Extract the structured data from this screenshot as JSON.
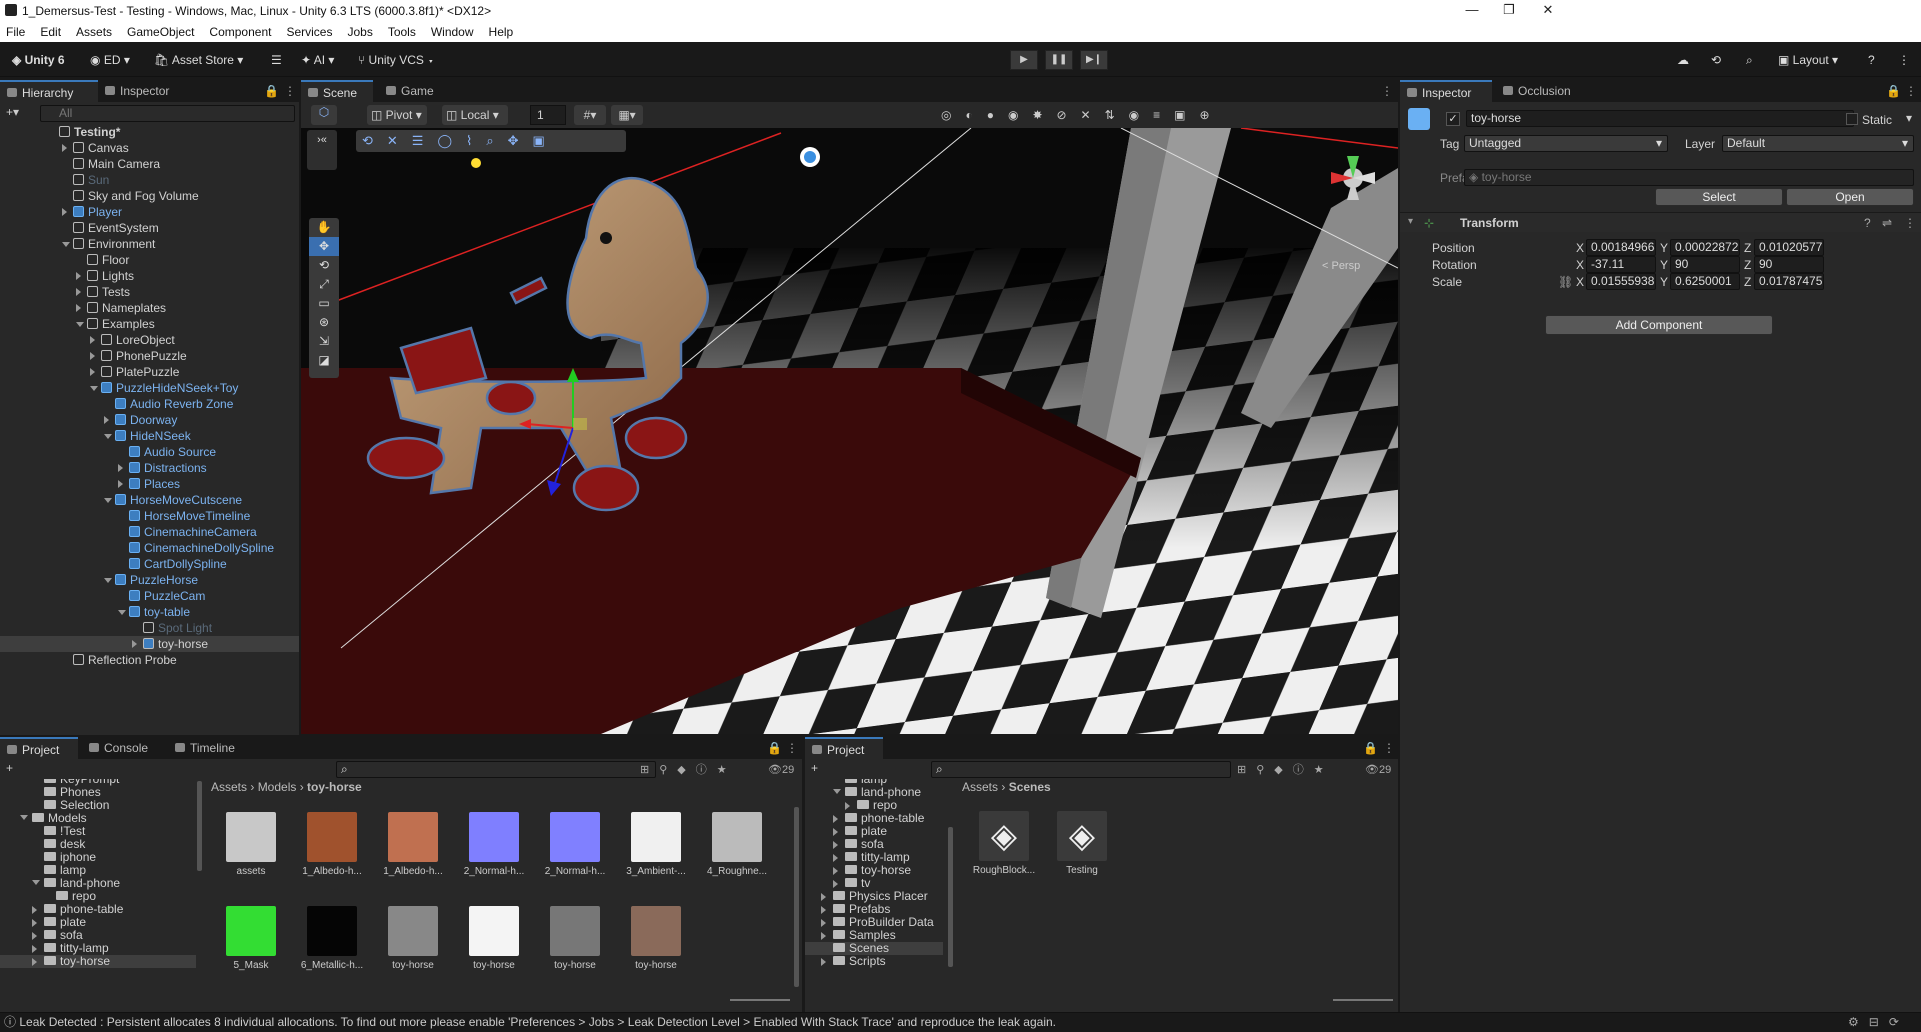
{
  "window": {
    "title": "1_Demersus-Test - Testing - Windows, Mac, Linux - Unity 6.3 LTS (6000.3.8f1)* <DX12>",
    "controls": [
      "—",
      "❐",
      "✕"
    ]
  },
  "menu": [
    "File",
    "Edit",
    "Assets",
    "GameObject",
    "Component",
    "Services",
    "Jobs",
    "Tools",
    "Window",
    "Help"
  ],
  "toolbar": {
    "unity": "Unity 6",
    "account": "ED",
    "asset_store": "Asset Store",
    "ai": "AI",
    "vcs": "Unity VCS",
    "layout": "Layout"
  },
  "hierarchy": {
    "tabs": [
      "Hierarchy",
      "Inspector"
    ],
    "search_placeholder": "All",
    "rows": [
      {
        "label": "Testing*",
        "indent": 0,
        "type": "scene",
        "expanded": true
      },
      {
        "label": "Canvas",
        "indent": 1,
        "type": "go",
        "arrow": "right"
      },
      {
        "label": "Main Camera",
        "indent": 1,
        "type": "go"
      },
      {
        "label": "Sun",
        "indent": 1,
        "type": "dis"
      },
      {
        "label": "Sky and Fog Volume",
        "indent": 1,
        "type": "go"
      },
      {
        "label": "Player",
        "indent": 1,
        "type": "prefab",
        "arrow": "right"
      },
      {
        "label": "EventSystem",
        "indent": 1,
        "type": "go"
      },
      {
        "label": "Environment",
        "indent": 1,
        "type": "go",
        "arrow": "down"
      },
      {
        "label": "Floor",
        "indent": 2,
        "type": "go"
      },
      {
        "label": "Lights",
        "indent": 2,
        "type": "go",
        "arrow": "right"
      },
      {
        "label": "Tests",
        "indent": 2,
        "type": "go",
        "arrow": "right"
      },
      {
        "label": "Nameplates",
        "indent": 2,
        "type": "go",
        "arrow": "right"
      },
      {
        "label": "Examples",
        "indent": 2,
        "type": "go",
        "arrow": "down"
      },
      {
        "label": "LoreObject",
        "indent": 3,
        "type": "go",
        "arrow": "right"
      },
      {
        "label": "PhonePuzzle",
        "indent": 3,
        "type": "go",
        "arrow": "right"
      },
      {
        "label": "PlatePuzzle",
        "indent": 3,
        "type": "go",
        "arrow": "right"
      },
      {
        "label": "PuzzleHideNSeek+Toy",
        "indent": 3,
        "type": "prefab",
        "arrow": "down"
      },
      {
        "label": "Audio Reverb Zone",
        "indent": 4,
        "type": "prefab"
      },
      {
        "label": "Doorway",
        "indent": 4,
        "type": "prefab",
        "arrow": "right"
      },
      {
        "label": "HideNSeek",
        "indent": 4,
        "type": "prefab",
        "arrow": "down"
      },
      {
        "label": "Audio Source",
        "indent": 5,
        "type": "prefab"
      },
      {
        "label": "Distractions",
        "indent": 5,
        "type": "prefab",
        "arrow": "right"
      },
      {
        "label": "Places",
        "indent": 5,
        "type": "prefab",
        "arrow": "right"
      },
      {
        "label": "HorseMoveCutscene",
        "indent": 4,
        "type": "prefab",
        "arrow": "down"
      },
      {
        "label": "HorseMoveTimeline",
        "indent": 5,
        "type": "prefab"
      },
      {
        "label": "CinemachineCamera",
        "indent": 5,
        "type": "prefab"
      },
      {
        "label": "CinemachineDollySpline",
        "indent": 5,
        "type": "prefab"
      },
      {
        "label": "CartDollySpline",
        "indent": 5,
        "type": "prefab"
      },
      {
        "label": "PuzzleHorse",
        "indent": 4,
        "type": "prefab",
        "arrow": "down"
      },
      {
        "label": "PuzzleCam",
        "indent": 5,
        "type": "prefab"
      },
      {
        "label": "toy-table",
        "indent": 5,
        "type": "prefab",
        "arrow": "down"
      },
      {
        "label": "Spot Light",
        "indent": 6,
        "type": "dis"
      },
      {
        "label": "toy-horse",
        "indent": 6,
        "type": "selected",
        "arrow": "right"
      },
      {
        "label": "Reflection Probe",
        "indent": 1,
        "type": "go"
      }
    ]
  },
  "scene": {
    "tabs": [
      "Scene",
      "Game"
    ],
    "pivot": "Pivot",
    "local": "Local",
    "grid_value": "1",
    "persp": "< Persp",
    "gizmo_axes": [
      "y",
      "z",
      "x"
    ]
  },
  "inspector": {
    "tabs": [
      "Inspector",
      "Occlusion"
    ],
    "name": "toy-horse",
    "static_label": "Static",
    "tag_label": "Tag",
    "tag": "Untagged",
    "layer_label": "Layer",
    "layer": "Default",
    "prefab_label": "Prefab",
    "prefab": "toy-horse",
    "select": "Select",
    "open": "Open",
    "transform": "Transform",
    "position_label": "Position",
    "rotation_label": "Rotation",
    "scale_label": "Scale",
    "position": {
      "x": "0.001849668",
      "y": "0.000228726",
      "z": "0.01020577"
    },
    "rotation": {
      "x": "-37.11",
      "y": "90",
      "z": "90"
    },
    "scale": {
      "x": "0.01555938",
      "y": "0.6250001",
      "z": "0.01787475"
    },
    "axis": {
      "x": "X",
      "y": "Y",
      "z": "Z"
    },
    "add_component": "Add Component"
  },
  "project_left": {
    "tabs": [
      "Project",
      "Console",
      "Timeline"
    ],
    "count": "29",
    "tree": [
      "KeyPrompt",
      "Phones",
      "Selection",
      "Models",
      "!Test",
      "desk",
      "iphone",
      "lamp",
      "land-phone",
      "repo",
      "phone-table",
      "plate",
      "sofa",
      "titty-lamp",
      "toy-horse"
    ],
    "breadcrumb": [
      "Assets",
      "Models",
      "toy-horse"
    ],
    "assets": [
      {
        "label": "assets",
        "color": "#c8c8c8"
      },
      {
        "label": "1_Albedo-h...",
        "color": "#a0522d"
      },
      {
        "label": "1_Albedo-h...",
        "color": "#c07050"
      },
      {
        "label": "2_Normal-h...",
        "color": "#7f7fff"
      },
      {
        "label": "2_Normal-h...",
        "color": "#8080ff"
      },
      {
        "label": "3_Ambient-...",
        "color": "#f0f0f0"
      },
      {
        "label": "4_Roughne...",
        "color": "#bbbbbb"
      },
      {
        "label": "5_Mask",
        "color": "#33dd33"
      },
      {
        "label": "6_Metallic-h...",
        "color": "#050505"
      },
      {
        "label": "toy-horse",
        "color": "#888888"
      },
      {
        "label": "toy-horse",
        "color": "#f4f4f4"
      },
      {
        "label": "toy-horse",
        "color": "#777777"
      },
      {
        "label": "toy-horse",
        "color": "#8a6a5a"
      }
    ]
  },
  "project_right": {
    "tab": "Project",
    "count": "29",
    "tree": [
      "lamp",
      "land-phone",
      "repo",
      "phone-table",
      "plate",
      "sofa",
      "titty-lamp",
      "toy-horse",
      "tv",
      "Physics Placer",
      "Prefabs",
      "ProBuilder Data",
      "Samples",
      "Scenes",
      "Scripts"
    ],
    "breadcrumb": [
      "Assets",
      "Scenes"
    ],
    "assets": [
      "RoughBlock...",
      "Testing"
    ]
  },
  "status": "Leak Detected : Persistent allocates 8 individual allocations. To find out more please enable 'Preferences > Jobs > Leak Detection Level > Enabled With Stack Trace' and reproduce the leak again."
}
